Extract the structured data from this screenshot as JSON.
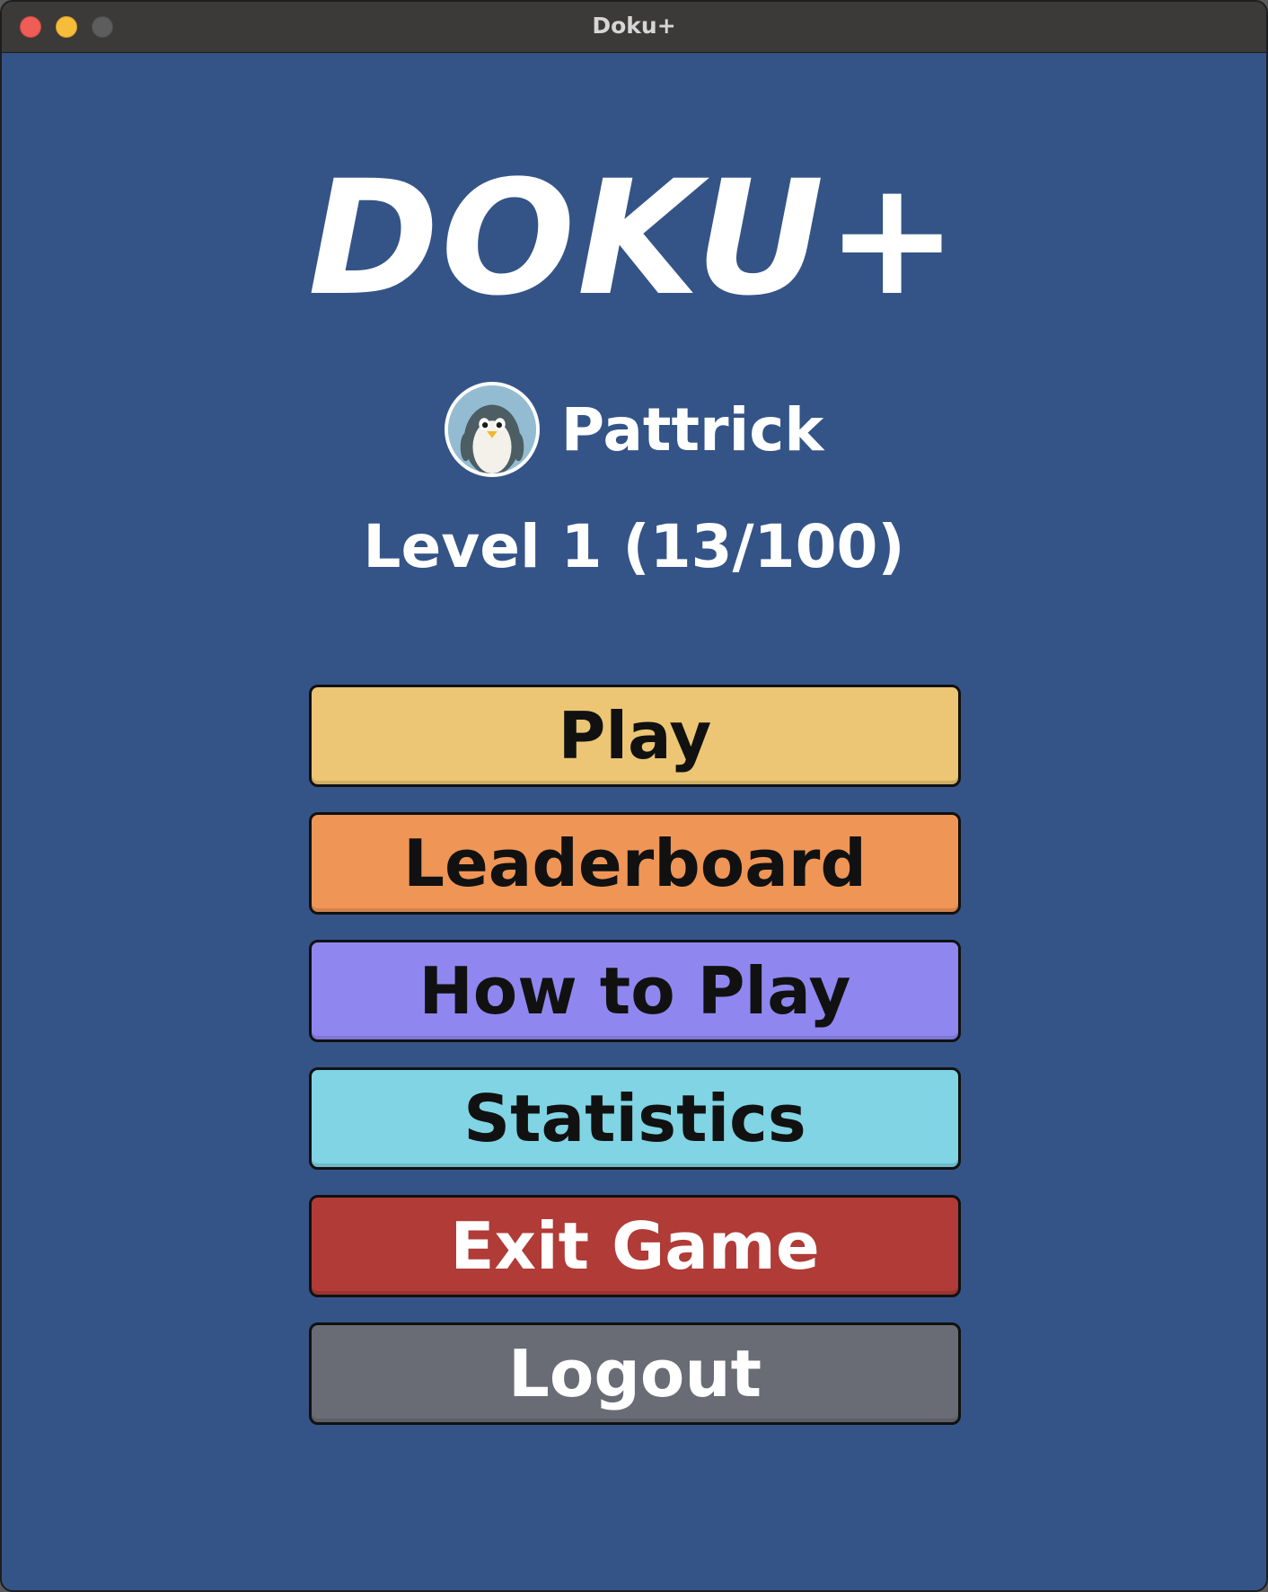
{
  "window": {
    "title": "Doku+"
  },
  "app": {
    "logo_text": "DOKU+"
  },
  "profile": {
    "username": "Pattrick",
    "avatar_icon": "penguin-avatar-icon",
    "level_text": "Level 1 (13/100)"
  },
  "menu": {
    "buttons": [
      {
        "id": "play",
        "label": "Play",
        "color": "#ecc675",
        "text_color": "#111111"
      },
      {
        "id": "leaderboard",
        "label": "Leaderboard",
        "color": "#ef9556",
        "text_color": "#111111"
      },
      {
        "id": "how-to-play",
        "label": "How to Play",
        "color": "#8f87ef",
        "text_color": "#111111"
      },
      {
        "id": "statistics",
        "label": "Statistics",
        "color": "#80d4e4",
        "text_color": "#111111"
      },
      {
        "id": "exit-game",
        "label": "Exit Game",
        "color": "#b03b37",
        "text_color": "#ffffff"
      },
      {
        "id": "logout",
        "label": "Logout",
        "color": "#696c75",
        "text_color": "#ffffff"
      }
    ]
  },
  "colors": {
    "background": "#345487",
    "titlebar": "#3b3a39"
  }
}
